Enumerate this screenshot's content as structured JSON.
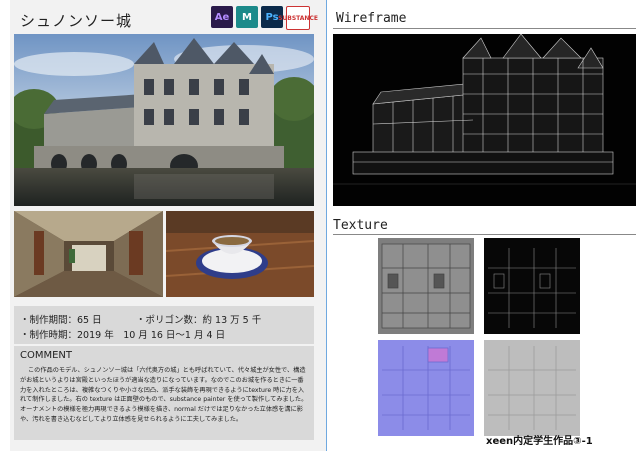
{
  "left": {
    "title": "シュノンソー城",
    "logos": [
      {
        "label": "Ae",
        "icon": "after-effects-icon"
      },
      {
        "label": "M",
        "icon": "maya-icon"
      },
      {
        "label": "Ps",
        "icon": "photoshop-icon"
      },
      {
        "label": "SUBSTANCE",
        "icon": "substance-painter-icon"
      }
    ],
    "info": {
      "period_label": "・制作期間：65 日",
      "polygon_label": "・ポリゴン数：約 13 万 5 千",
      "timing_label": "・制作時期：2019 年　10 月 16 日～1 月 4 日"
    },
    "comment": {
      "heading": "COMMENT",
      "text": "この作品のモデル、シュノンソー城は「六代奥方の城」とも呼ばれていて、代々城主が女性で、構造がお城というよりは宮殿といったほうが適当な造りになっています。なのでこのお城を作るときに一番力を入れたところは、複雑なつくりや小さな凹凸、派手な装飾を再現できるようにtexture 時に力を入れて制作しました。右の texture は正面壁のもので、substance painter を使って製作してみました。オーナメントの模様を極力再現できるよう模様を描き、normal だけでは足りなかった立体感を溝に影や、汚れを書き込むなどしてより立体感を見せられるように工夫してみました。"
    }
  },
  "right": {
    "wireframe_heading": "Wireframe",
    "texture_heading": "Texture"
  },
  "footer": "xeen内定学生作品③-1",
  "colors": {
    "guide": "#6fa9e0",
    "panel": "#f2f2f2",
    "info_bg": "#d9d9d9"
  }
}
